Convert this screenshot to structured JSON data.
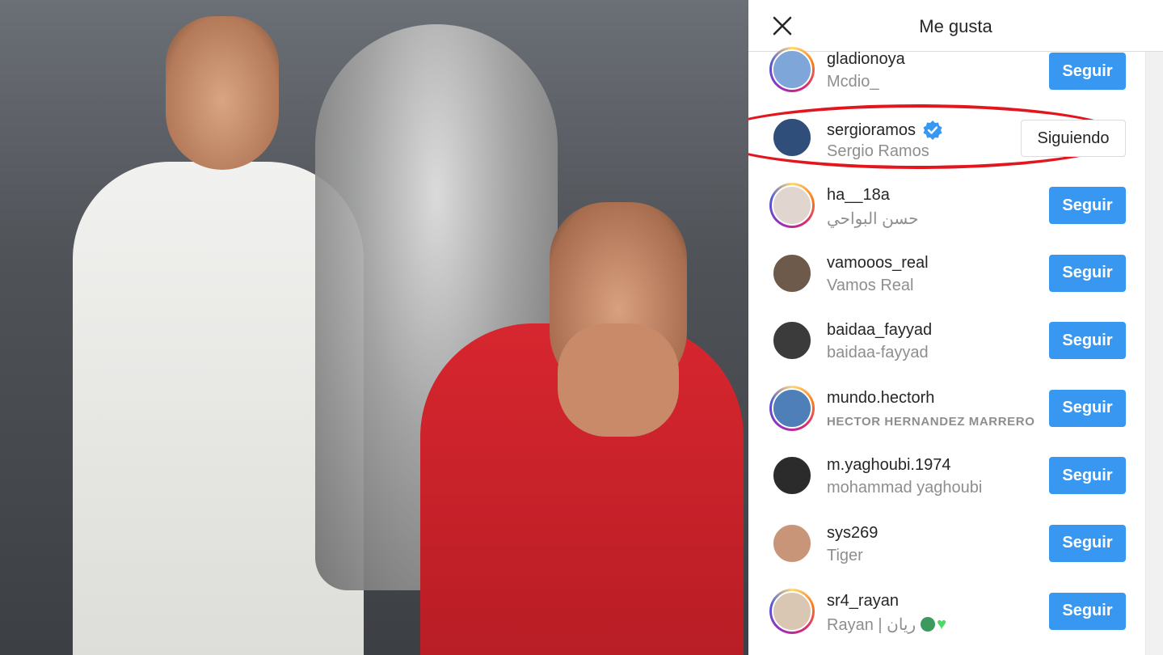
{
  "dialog": {
    "title": "Me gusta",
    "close_icon": "close-icon"
  },
  "colors": {
    "follow_button": "#3897f0",
    "verified_badge": "#3897f0",
    "highlight_circle": "#e3161e",
    "username_text": "#262626",
    "fullname_text": "#8e8e8e"
  },
  "likes": [
    {
      "username": "gladionoya",
      "full_name": "Mcdio_",
      "button": "Seguir",
      "verified": false,
      "avatar_color": "#7ea6d8"
    },
    {
      "username": "sergioramos",
      "full_name": "Sergio Ramos",
      "button": "Siguiendo",
      "verified": true,
      "avatar_color": "#2f4f7a"
    },
    {
      "username": "ha__18a",
      "full_name": "حسن البواحي",
      "button": "Seguir",
      "verified": false,
      "avatar_color": "#e0d6cf"
    },
    {
      "username": "vamooos_real",
      "full_name": "Vamos Real",
      "button": "Seguir",
      "verified": false,
      "avatar_color": "#6d5a4a"
    },
    {
      "username": "baidaa_fayyad",
      "full_name": "baidaa-fayyad",
      "button": "Seguir",
      "verified": false,
      "avatar_color": "#3b3b3b"
    },
    {
      "username": "mundo.hectorh",
      "full_name": "HECTOR HERNANDEZ MARRERO",
      "button": "Seguir",
      "verified": false,
      "avatar_color": "#4f7fb8"
    },
    {
      "username": "m.yaghoubi.1974",
      "full_name": "mohammad yaghoubi",
      "button": "Seguir",
      "verified": false,
      "avatar_color": "#2b2b2b"
    },
    {
      "username": "sys269",
      "full_name": "Tiger",
      "button": "Seguir",
      "verified": false,
      "avatar_color": "#c99579"
    },
    {
      "username": "sr4_rayan",
      "full_name": "Rayan | ريان",
      "button": "Seguir",
      "verified": false,
      "avatar_color": "#d9c7b3"
    }
  ]
}
